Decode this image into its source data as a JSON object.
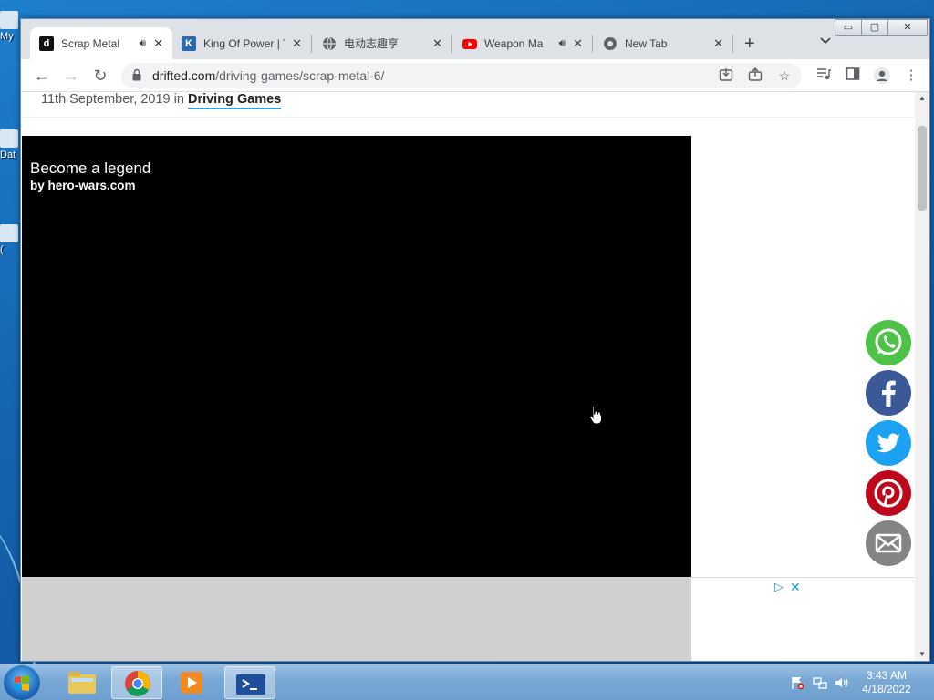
{
  "desktop": {
    "icons": [
      {
        "label": "My"
      },
      {
        "label": "Dat"
      },
      {
        "label": "("
      }
    ]
  },
  "window_controls": {
    "minimize": "▭",
    "maximize": "▢",
    "close": "✕"
  },
  "tabs": [
    {
      "title": "Scrap Metal",
      "favicon": "d",
      "audio": true,
      "active": true
    },
    {
      "title": "King Of Power | T",
      "favicon": "K",
      "audio": false,
      "active": false
    },
    {
      "title": "电动志趣享",
      "favicon": "globe",
      "audio": false,
      "active": false
    },
    {
      "title": "Weapon Ma",
      "favicon": "youtube",
      "audio": true,
      "active": false
    },
    {
      "title": "New Tab",
      "favicon": "chrome",
      "audio": false,
      "active": false
    }
  ],
  "toolbar": {
    "new_tab": "+",
    "tab_search": "⌄",
    "back": "←",
    "forward": "→",
    "reload": "↻",
    "url_domain": "drifted.com",
    "url_path": "/driving-games/scrap-metal-6/"
  },
  "page": {
    "meta_prefix": "11th September, 2019 in ",
    "meta_category": "Driving Games",
    "ad": {
      "headline": "Become a legend",
      "byline": "by hero-wars.com",
      "adchoices": "▷",
      "close": "✕"
    },
    "share_buttons": [
      {
        "name": "whatsapp",
        "color": "#4dc247"
      },
      {
        "name": "facebook",
        "color": "#3b5998"
      },
      {
        "name": "twitter",
        "color": "#1da1f2"
      },
      {
        "name": "pinterest",
        "color": "#bd081c"
      },
      {
        "name": "email",
        "color": "#848484"
      }
    ]
  },
  "taskbar": {
    "time": "3:43 AM",
    "date": "4/18/2022"
  }
}
